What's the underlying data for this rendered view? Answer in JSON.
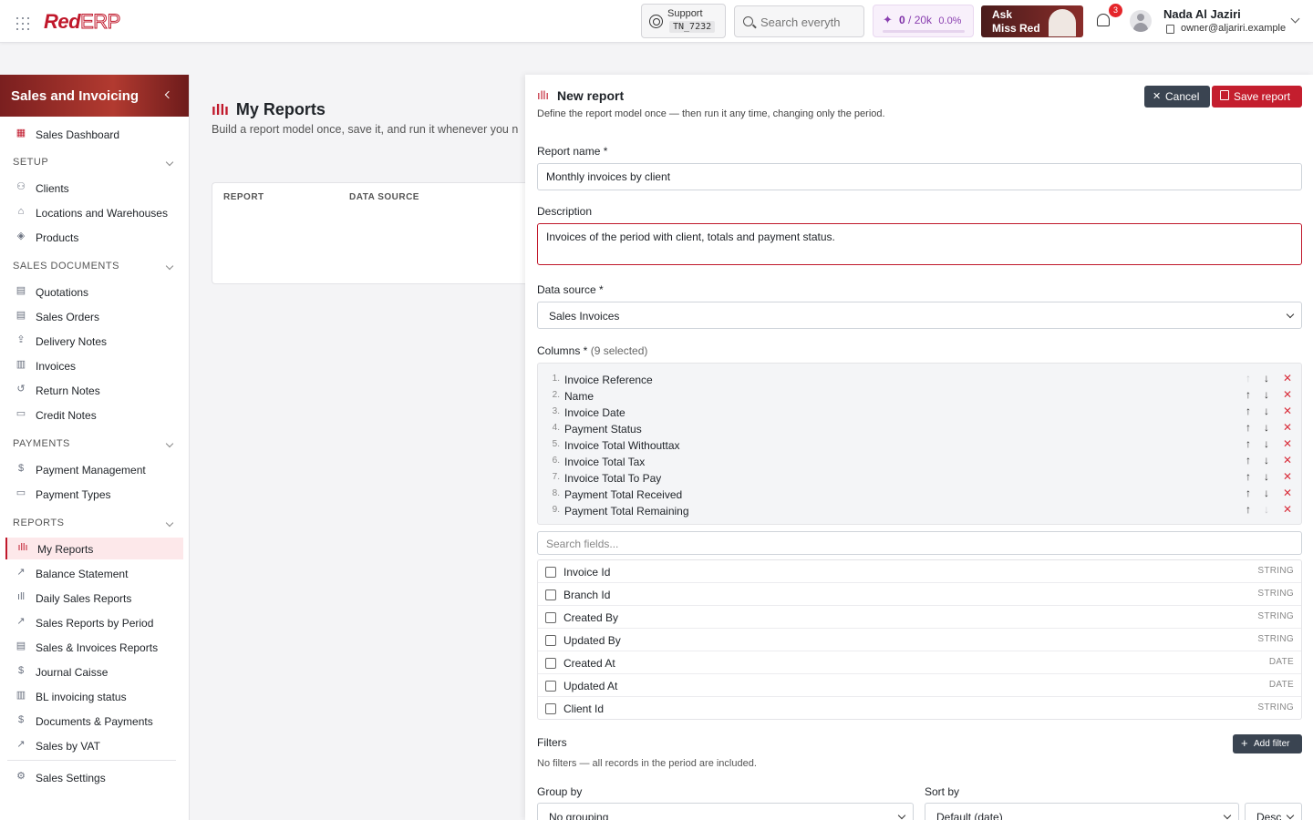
{
  "topbar": {
    "logo_red": "Red",
    "logo_erp": "ERP",
    "support_label": "Support",
    "support_code": "TN_7232",
    "search_placeholder": "Search everyth",
    "credits_used": "0",
    "credits_total": "/ 20k",
    "credits_pct": "0.0%",
    "ask_line1": "Ask",
    "ask_line2": "Miss Red",
    "notifications": "3",
    "user_name": "Nada Al Jaziri",
    "user_email": "owner@aljariri.example"
  },
  "sidebar": {
    "title": "Sales and Invoicing",
    "dashboard": "Sales Dashboard",
    "sections": {
      "setup": "SETUP",
      "sales_documents": "SALES DOCUMENTS",
      "payments": "PAYMENTS",
      "reports": "REPORTS"
    },
    "setup_items": [
      "Clients",
      "Locations and Warehouses",
      "Products"
    ],
    "sales_items": [
      "Quotations",
      "Sales Orders",
      "Delivery Notes",
      "Invoices",
      "Return Notes",
      "Credit Notes"
    ],
    "payment_items": [
      "Payment Management",
      "Payment Types"
    ],
    "report_items": [
      "My Reports",
      "Balance Statement",
      "Daily Sales Reports",
      "Sales Reports by Period",
      "Sales & Invoices Reports",
      "Journal Caisse",
      "BL invoicing status",
      "Documents & Payments",
      "Sales by VAT"
    ],
    "settings": "Sales Settings"
  },
  "main": {
    "title": "My Reports",
    "subtitle": "Build a report model once, save it, and run it whenever you n",
    "col_report": "REPORT",
    "col_source": "DATA SOURCE"
  },
  "panel": {
    "title": "New report",
    "subtitle": "Define the report model once — then run it any time, changing only the period.",
    "cancel": "Cancel",
    "save": "Save report",
    "name_label": "Report name *",
    "name_value": "Monthly invoices by client",
    "desc_label": "Description",
    "desc_value": "Invoices of the period with client, totals and payment status.",
    "source_label": "Data source *",
    "source_value": "Sales Invoices",
    "columns_label": "Columns *",
    "columns_count": "(9 selected)",
    "columns": [
      {
        "n": "1.",
        "name": "Invoice Reference"
      },
      {
        "n": "2.",
        "name": "Name"
      },
      {
        "n": "3.",
        "name": "Invoice Date"
      },
      {
        "n": "4.",
        "name": "Payment Status"
      },
      {
        "n": "5.",
        "name": "Invoice Total Withouttax"
      },
      {
        "n": "6.",
        "name": "Invoice Total Tax"
      },
      {
        "n": "7.",
        "name": "Invoice Total To Pay"
      },
      {
        "n": "8.",
        "name": "Payment Total Received"
      },
      {
        "n": "9.",
        "name": "Payment Total Remaining"
      }
    ],
    "field_search_placeholder": "Search fields...",
    "fields": [
      {
        "name": "Invoice Id",
        "type": "STRING"
      },
      {
        "name": "Branch Id",
        "type": "STRING"
      },
      {
        "name": "Created By",
        "type": "STRING"
      },
      {
        "name": "Updated By",
        "type": "STRING"
      },
      {
        "name": "Created At",
        "type": "DATE"
      },
      {
        "name": "Updated At",
        "type": "DATE"
      },
      {
        "name": "Client Id",
        "type": "STRING"
      }
    ],
    "filters_label": "Filters",
    "add_filter": "Add filter",
    "filters_note": "No filters — all records in the period are included.",
    "group_label": "Group by",
    "group_value": "No grouping",
    "sort_label": "Sort by",
    "sort_value": "Default (date)",
    "sort_dir": "Desc"
  }
}
